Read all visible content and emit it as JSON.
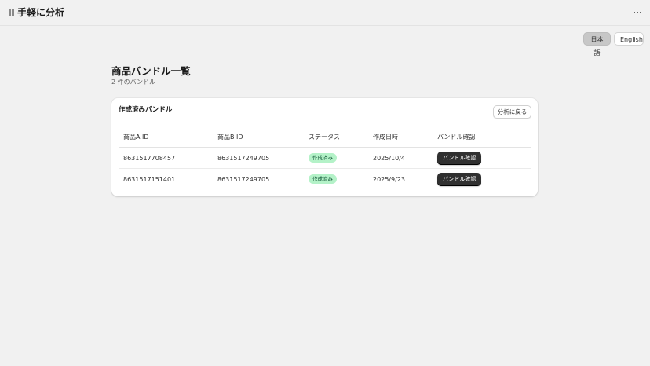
{
  "header": {
    "app_icon": "grid-icon",
    "title": "手軽に分析",
    "more_icon": "ellipsis-icon"
  },
  "language": {
    "options": [
      "日本語",
      "English"
    ],
    "selected": "日本語"
  },
  "page": {
    "title": "商品バンドル一覧",
    "subtitle": "2 件のバンドル"
  },
  "card": {
    "title": "作成済みバンドル",
    "back_button": "分析に戻る",
    "columns": [
      "商品A ID",
      "商品B ID",
      "ステータス",
      "作成日時",
      "バンドル確認"
    ],
    "rows": [
      {
        "product_a": "8631517708457",
        "product_b": "8631517249705",
        "status": "作成済み",
        "created": "2025/10/4",
        "action": "バンドル確認"
      },
      {
        "product_a": "8631517151401",
        "product_b": "8631517249705",
        "status": "作成済み",
        "created": "2025/9/23",
        "action": "バンドル確認"
      }
    ]
  },
  "colors": {
    "background": "#f1f1f1",
    "status_badge_bg": "#b4f2c8",
    "status_badge_text": "#0c5132",
    "primary_button": "#303030",
    "active_language_bg": "#c7c7c7"
  }
}
